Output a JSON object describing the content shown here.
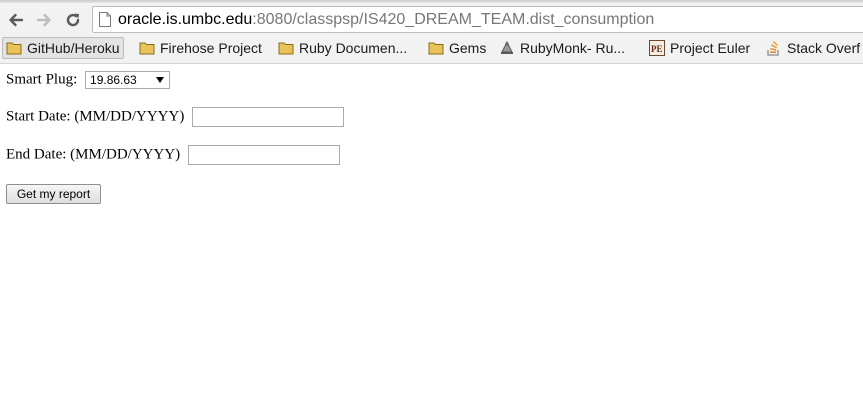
{
  "browser": {
    "url_host": "oracle.is.umbc.edu",
    "url_rest": ":8080/classpsp/IS420_DREAM_TEAM.dist_consumption",
    "nav_icons": [
      "back-icon",
      "forward-icon",
      "reload-icon",
      "page-icon"
    ],
    "bookmarks": [
      {
        "label": "GitHub/Heroku",
        "icon": "folder-icon",
        "active": true
      },
      {
        "label": "Firehose Project",
        "icon": "folder-icon"
      },
      {
        "label": "Ruby Documen...",
        "icon": "folder-icon"
      },
      {
        "label": "Gems",
        "icon": "folder-icon"
      },
      {
        "label": "RubyMonk- Ru...",
        "icon": "rubymonk-icon"
      },
      {
        "label": "Project Euler",
        "icon": "project-euler-icon"
      },
      {
        "label": "Stack Overf",
        "icon": "stackoverflow-icon"
      }
    ]
  },
  "form": {
    "smart_plug_label": "Smart Plug:",
    "smart_plug_value": "19.86.63",
    "start_date_label": "Start Date: (MM/DD/YYYY)",
    "start_date_value": "",
    "end_date_label": "End Date: (MM/DD/YYYY)",
    "end_date_value": "",
    "submit_label": "Get my report"
  },
  "colors": {
    "folder": "#e7c35a",
    "url_host": "#000000",
    "url_rest": "#777777"
  }
}
